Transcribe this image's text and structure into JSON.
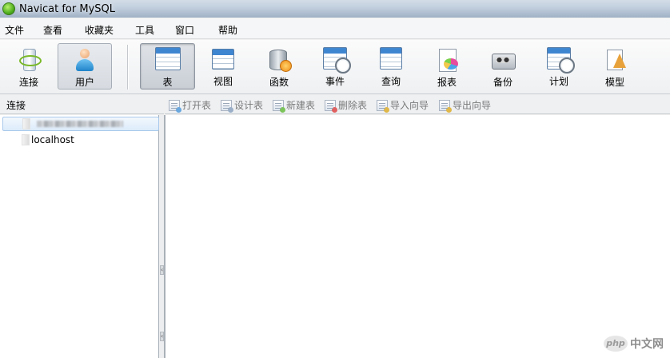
{
  "window": {
    "title": "Navicat for MySQL"
  },
  "menu": [
    "文件",
    "查看",
    "收藏夹",
    "工具",
    "窗口",
    "帮助"
  ],
  "toolbar": [
    {
      "label": "连接",
      "icon": "connection-icon"
    },
    {
      "label": "用户",
      "icon": "user-icon",
      "state": "pressed"
    },
    {
      "label": "表",
      "icon": "table-icon",
      "state": "active"
    },
    {
      "label": "视图",
      "icon": "view-icon"
    },
    {
      "label": "函数",
      "icon": "function-icon"
    },
    {
      "label": "事件",
      "icon": "event-icon"
    },
    {
      "label": "查询",
      "icon": "query-icon"
    },
    {
      "label": "报表",
      "icon": "report-icon"
    },
    {
      "label": "备份",
      "icon": "backup-icon"
    },
    {
      "label": "计划",
      "icon": "schedule-icon"
    },
    {
      "label": "模型",
      "icon": "model-icon"
    }
  ],
  "connection_panel": {
    "header": "连接",
    "items": [
      {
        "label": "",
        "note": "blurred connection name",
        "selected": true
      },
      {
        "label": "localhost",
        "selected": false
      }
    ]
  },
  "object_toolbar": [
    {
      "label": "打开表",
      "icon": "open-table-icon"
    },
    {
      "label": "设计表",
      "icon": "design-table-icon"
    },
    {
      "label": "新建表",
      "icon": "new-table-icon"
    },
    {
      "label": "删除表",
      "icon": "delete-table-icon"
    },
    {
      "label": "导入向导",
      "icon": "import-wizard-icon"
    },
    {
      "label": "导出向导",
      "icon": "export-wizard-icon"
    }
  ],
  "watermark": {
    "logo": "php",
    "text": "中文网"
  },
  "colors": {
    "selection": "#dcebfb",
    "title_bar": "#c3d0de",
    "disabled_text": "#7a7a7a"
  }
}
